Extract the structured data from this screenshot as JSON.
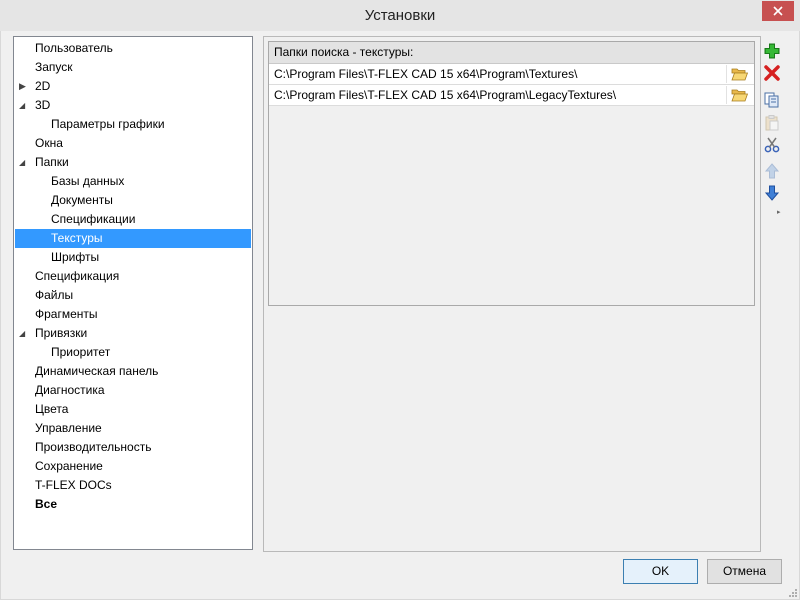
{
  "window": {
    "title": "Установки"
  },
  "tree": {
    "items": [
      {
        "label": "Пользователь",
        "level": 0
      },
      {
        "label": "Запуск",
        "level": 0
      },
      {
        "label": "2D",
        "level": 0,
        "expander": "collapsed"
      },
      {
        "label": "3D",
        "level": 0,
        "expander": "expanded"
      },
      {
        "label": "Параметры графики",
        "level": 1
      },
      {
        "label": "Окна",
        "level": 0
      },
      {
        "label": "Папки",
        "level": 0,
        "expander": "expanded"
      },
      {
        "label": "Базы данных",
        "level": 1
      },
      {
        "label": "Документы",
        "level": 1
      },
      {
        "label": "Спецификации",
        "level": 1
      },
      {
        "label": "Текстуры",
        "level": 1,
        "selected": true
      },
      {
        "label": "Шрифты",
        "level": 1
      },
      {
        "label": "Спецификация",
        "level": 0
      },
      {
        "label": "Файлы",
        "level": 0
      },
      {
        "label": "Фрагменты",
        "level": 0
      },
      {
        "label": "Привязки",
        "level": 0,
        "expander": "expanded"
      },
      {
        "label": "Приоритет",
        "level": 1
      },
      {
        "label": "Динамическая панель",
        "level": 0
      },
      {
        "label": "Диагностика",
        "level": 0
      },
      {
        "label": "Цвета",
        "level": 0
      },
      {
        "label": "Управление",
        "level": 0
      },
      {
        "label": "Производительность",
        "level": 0
      },
      {
        "label": "Сохранение",
        "level": 0
      },
      {
        "label": "T-FLEX DOCs",
        "level": 0
      },
      {
        "label": "Все",
        "level": 0,
        "bold": true
      }
    ]
  },
  "paths": {
    "header": "Папки поиска - текстуры:",
    "rows": [
      "C:\\Program Files\\T-FLEX CAD 15 x64\\Program\\Textures\\",
      "C:\\Program Files\\T-FLEX CAD 15 x64\\Program\\LegacyTextures\\"
    ]
  },
  "toolbar": {
    "buttons": [
      "add-icon",
      "delete-icon",
      "copy-icon",
      "paste-icon",
      "cut-icon",
      "move-up-icon",
      "move-down-icon"
    ]
  },
  "buttons": {
    "ok": "OK",
    "cancel": "Отмена"
  },
  "colors": {
    "selection": "#3399ff",
    "close_button": "#c75050"
  }
}
